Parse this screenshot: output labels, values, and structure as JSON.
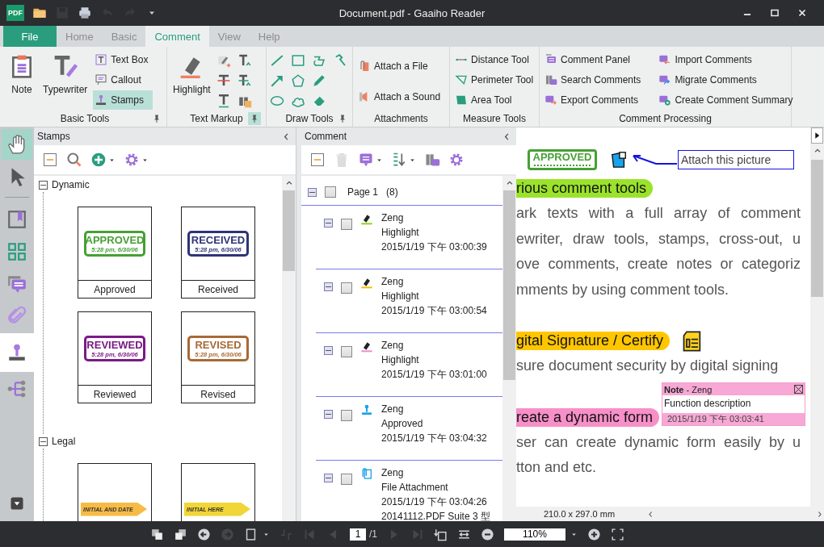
{
  "window": {
    "logo_text": "PDF",
    "title": "Document.pdf - Gaaiho Reader"
  },
  "quick_access": [
    {
      "kind": "folder",
      "disabled": false
    },
    {
      "kind": "floppy",
      "disabled": true
    },
    {
      "kind": "printer",
      "disabled": false
    },
    {
      "kind": "undo",
      "disabled": true
    },
    {
      "kind": "redo",
      "disabled": true
    },
    {
      "kind": "caret",
      "disabled": false
    }
  ],
  "file_tab": "File",
  "menu_tabs": [
    {
      "label": "Home",
      "selected": false
    },
    {
      "label": "Basic",
      "selected": false
    },
    {
      "label": "Comment",
      "selected": true
    },
    {
      "label": "View",
      "selected": false
    },
    {
      "label": "Help",
      "selected": false
    }
  ],
  "ribbon": [
    {
      "title": "Basic Tools",
      "kind": "basic",
      "pinned": false,
      "large": [
        {
          "kind": "note",
          "label": "Note",
          "selected": false
        },
        {
          "kind": "typewriter",
          "label": "Typewriter",
          "selected": false
        }
      ],
      "small": [
        {
          "kind": "text-box",
          "label": "Text Box",
          "selected": false
        },
        {
          "kind": "callout",
          "label": "Callout",
          "selected": false
        },
        {
          "kind": "stamp",
          "label": "Stamps",
          "selected": true
        }
      ]
    },
    {
      "title": "Text Markup",
      "kind": "markup",
      "pinned": true,
      "large": [
        {
          "kind": "highlighter",
          "label": "Highlight",
          "selected": false
        }
      ]
    },
    {
      "title": "Draw Tools",
      "kind": "draw",
      "pinned": false
    },
    {
      "title": "Attachments",
      "kind": "list",
      "small": [
        {
          "kind": "paperclip-file",
          "label": "Attach a File",
          "selected": false
        },
        {
          "kind": "speaker",
          "label": "Attach a Sound",
          "selected": false
        }
      ]
    },
    {
      "title": "Measure Tools",
      "kind": "list",
      "small": [
        {
          "kind": "distance",
          "label": "Distance Tool",
          "selected": false
        },
        {
          "kind": "perimeter",
          "label": "Perimeter Tool",
          "selected": false
        },
        {
          "kind": "area",
          "label": "Area Tool",
          "selected": false
        }
      ]
    },
    {
      "title": "Comment Processing",
      "kind": "columns",
      "small": [
        {
          "kind": "comment-panel",
          "label": "Comment Panel",
          "selected": false
        },
        {
          "kind": "binoculars-comment",
          "label": "Search Comments",
          "selected": false
        },
        {
          "kind": "comment-export",
          "label": "Export Comments",
          "selected": false
        },
        {
          "kind": "comment-import",
          "label": "Import Comments",
          "selected": false
        },
        {
          "kind": "comment-migrate",
          "label": "Migrate Comments",
          "selected": false
        },
        {
          "kind": "comment-summary",
          "label": "Create Comment Summary",
          "selected": false
        }
      ]
    }
  ],
  "rail": [
    {
      "kind": "hand",
      "selected": true
    },
    {
      "kind": "pointer",
      "selected": false
    },
    {
      "kind": "bookmark",
      "open": false
    },
    {
      "kind": "grid",
      "open": false
    },
    {
      "kind": "speech-bubble",
      "open": false
    },
    {
      "kind": "paperclip",
      "open": false
    },
    {
      "kind": "stamp",
      "open": true
    },
    {
      "kind": "tree",
      "open": false
    }
  ],
  "stamps_panel": {
    "title": "Stamps",
    "categories": [
      {
        "label": "Dynamic",
        "expanded": true,
        "stamps": [
          {
            "kind": "dynamic",
            "caption": "Approved",
            "text": "APPROVED",
            "sub": "5:28 pm, 6/30/06",
            "color": "#46a034"
          },
          {
            "kind": "dynamic",
            "caption": "Received",
            "text": "RECEIVED",
            "sub": "5:28 pm, 6/30/06",
            "color": "#2e3478"
          },
          {
            "kind": "dynamic",
            "caption": "Reviewed",
            "text": "REVIEWED",
            "sub": "5:28 pm, 6/30/06",
            "color": "#7a1a86"
          },
          {
            "kind": "dynamic",
            "caption": "Revised",
            "text": "REVISED",
            "sub": "5:28 pm, 6/30/06",
            "color": "#a86a35"
          }
        ]
      },
      {
        "label": "Legal",
        "expanded": true,
        "stamps": [
          {
            "kind": "sign",
            "text": "INITIAL AND DATE",
            "color": "#f7bb45"
          },
          {
            "kind": "sign",
            "text": "INITIAL HERE",
            "color": "#f2d536"
          }
        ]
      }
    ]
  },
  "comment_panel": {
    "title": "Comment",
    "page": {
      "label": "Page 1",
      "count": "(8)",
      "expanded": true,
      "checked": false
    },
    "items": [
      {
        "kind": "highlight",
        "color": "#8cd317",
        "author": "Zeng",
        "type": "Highlight",
        "date": "2015/1/19 下午 03:00:39",
        "expanded": true,
        "checked": false
      },
      {
        "kind": "highlight",
        "color": "#f2c200",
        "author": "Zeng",
        "type": "Highlight",
        "date": "2015/1/19 下午 03:00:54",
        "expanded": true,
        "checked": false
      },
      {
        "kind": "highlight",
        "color": "#f08cc8",
        "author": "Zeng",
        "type": "Highlight",
        "date": "2015/1/19 下午 03:01:00",
        "expanded": true,
        "checked": false
      },
      {
        "kind": "stamp",
        "author": "Zeng",
        "type": "Approved",
        "date": "2015/1/19 下午 03:04:32",
        "expanded": true,
        "checked": false
      },
      {
        "kind": "attachment",
        "author": "Zeng",
        "type": "File Attachment",
        "date": "2015/1/19 下午 03:04:26",
        "extra": "20141112.PDF Suite 3 型",
        "expanded": true,
        "checked": false
      }
    ]
  },
  "document": {
    "stamp": {
      "text": "APPROVED",
      "color": "#46a034"
    },
    "callout": "Attach this picture",
    "sections": [
      {
        "heading": "rious comment tools",
        "color": "#9be22b",
        "note_icon": false,
        "lines": [
          "ark texts with a full array of comment",
          "ewriter, draw tools, stamps, cross-out, u",
          "ove comments, create notes or categoriz",
          "mments by using comment tools."
        ]
      },
      {
        "heading": "gital Signature / Certify",
        "color": "#ffc600",
        "note_icon": true,
        "lines": [
          "sure document security by digital signing"
        ]
      },
      {
        "heading": "reate a dynamic form",
        "color": "#f78fc8",
        "note_icon": false,
        "lines": [
          "ser can create dynamic form easily by u",
          "tton and etc."
        ]
      }
    ],
    "note": {
      "header": "**Note** - Zeng",
      "body": "Function description",
      "date": "2015/1/19 下午 03:03:41"
    },
    "page_size": "210.0 x 297.0 mm"
  },
  "bottom_bar": {
    "left": [
      {
        "kind": "page-stack",
        "disabled": false
      },
      {
        "kind": "page-arrange",
        "disabled": false
      },
      {
        "kind": "circle-left",
        "disabled": false
      },
      {
        "kind": "circle-right",
        "disabled": true
      },
      {
        "kind": "page-outline",
        "disabled": false
      },
      {
        "kind": "caret",
        "disabled": false
      },
      {
        "kind": "crop",
        "disabled": true
      },
      {
        "kind": "first-page",
        "disabled": true
      },
      {
        "kind": "previous",
        "disabled": true
      }
    ],
    "page_field": "1",
    "page_total": "/1",
    "middle": [
      {
        "kind": "next",
        "disabled": true
      },
      {
        "kind": "last-page",
        "disabled": true
      },
      {
        "kind": "rotate",
        "disabled": false
      },
      {
        "kind": "fit-width",
        "disabled": false
      },
      {
        "kind": "zoom-out",
        "disabled": false
      }
    ],
    "zoom": "110%",
    "right": [
      {
        "kind": "caret",
        "disabled": false
      },
      {
        "kind": "zoom-in",
        "disabled": false
      },
      {
        "kind": "full-screen",
        "disabled": false
      }
    ]
  }
}
